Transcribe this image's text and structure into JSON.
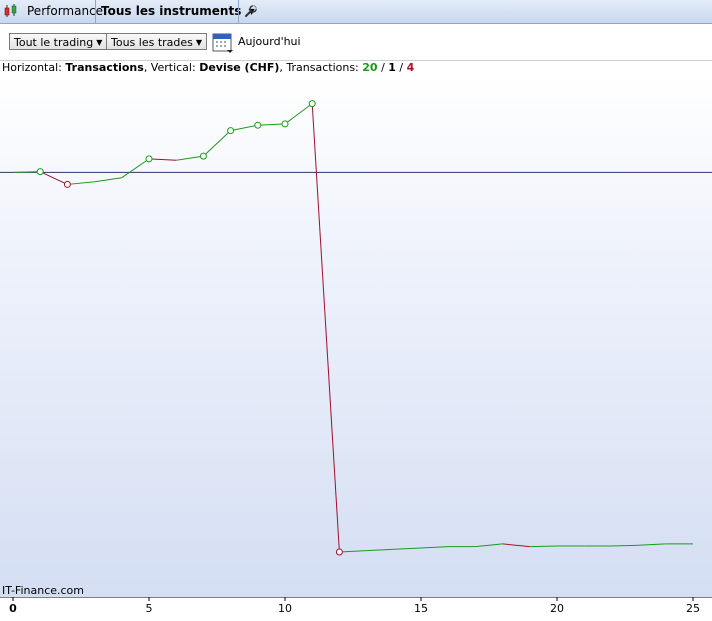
{
  "tabbar": {
    "performance_label": "Performance",
    "instruments_label": "Tous les instruments"
  },
  "toolbar": {
    "trading_filter": "Tout le trading",
    "trades_filter": "Tous les trades",
    "date_label": "Aujourd'hui"
  },
  "info": {
    "h_prefix": "Horizontal: ",
    "h_value": "Transactions",
    "v_prefix": ", Vertical: ",
    "v_value": "Devise (CHF)",
    "t_prefix": ", Transactions: ",
    "wins": "20",
    "sep1": " / ",
    "neutral": "1",
    "sep2": " / ",
    "losses": "4"
  },
  "watermark": "IT-Finance.com",
  "colors": {
    "win": "#1a9a1a",
    "loss": "#a0102a",
    "zero_line": "#2e3560"
  },
  "chart_data": {
    "type": "line",
    "xlabel": "",
    "ylabel": "",
    "x_ticks": [
      0,
      5,
      10,
      15,
      20,
      25
    ],
    "xlim": [
      0,
      25.5
    ],
    "ylim": [
      -282,
      50
    ],
    "zero_line": 0,
    "markers_at": [
      1,
      2,
      5,
      7,
      8,
      9,
      10,
      11,
      12
    ],
    "x": [
      0,
      1,
      2,
      3,
      4,
      5,
      6,
      7,
      8,
      9,
      10,
      11,
      12,
      13,
      14,
      15,
      16,
      17,
      18,
      19,
      20,
      21,
      22,
      23,
      24,
      25
    ],
    "y": [
      0,
      0.5,
      -9,
      -7,
      -4,
      10,
      9,
      12,
      31,
      35,
      36,
      51,
      -282,
      -281,
      -280,
      -279,
      -278,
      -278,
      -276,
      -278,
      -277.5,
      -277.5,
      -277.5,
      -277,
      -276,
      -276
    ]
  }
}
